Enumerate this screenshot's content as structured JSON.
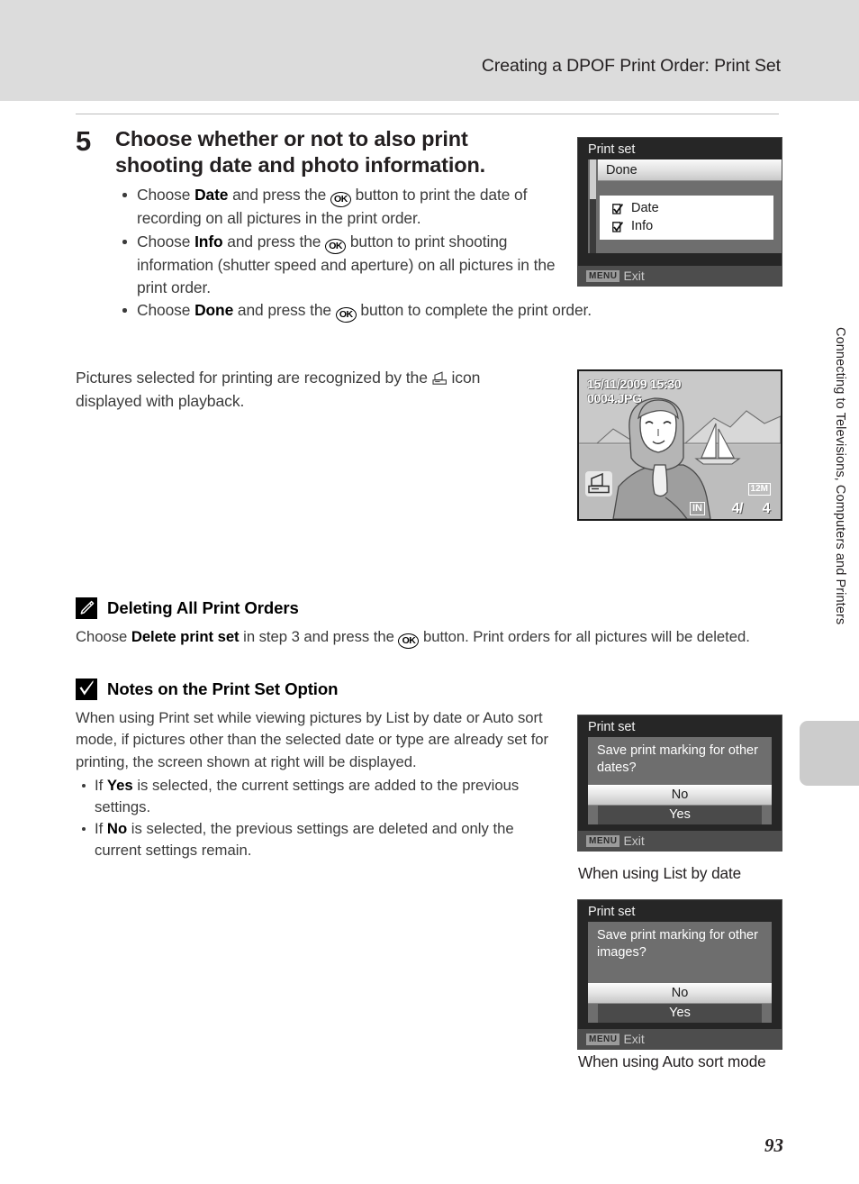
{
  "header": {
    "title": "Creating a DPOF Print Order: Print Set"
  },
  "side_tab": {
    "label": "Connecting to Televisions, Computers and Printers"
  },
  "step": {
    "number": "5",
    "heading": "Choose whether or not to also print shooting date and photo information.",
    "bullets": [
      {
        "pre": "Choose ",
        "bold": "Date",
        "mid": " and press the ",
        "icon": "OK",
        "post": " button to print the date of recording on all pictures in the print order."
      },
      {
        "pre": "Choose ",
        "bold": "Info",
        "mid": " and press the ",
        "icon": "OK",
        "post": " button to print shooting information (shutter speed and aperture) on all pictures in the print order."
      },
      {
        "pre": "Choose ",
        "bold": "Done",
        "mid": " and press the ",
        "icon": "OK",
        "post": " button to complete the print order."
      }
    ]
  },
  "paragraph": {
    "pre": "Pictures selected for printing are recognized by the ",
    "icon_name": "dpof-print-icon",
    "post": " icon displayed with playback."
  },
  "notes": [
    {
      "icon": "pencil-icon",
      "title": "Deleting All Print Orders",
      "body_pre": "Choose ",
      "body_bold": "Delete print set",
      "body_mid": " in step 3 and press the ",
      "body_icon": "OK",
      "body_post": " button. Print orders for all pictures will be deleted."
    },
    {
      "icon": "check-icon",
      "title": "Notes on the Print Set Option",
      "body": "When using Print set while viewing pictures by List by date or Auto sort mode, if pictures other than the selected date or type are already set for printing, the screen shown at right will be displayed.",
      "bullets": [
        {
          "pre": "If ",
          "bold": "Yes",
          "post": " is selected, the current settings are added to the previous settings."
        },
        {
          "pre": "If ",
          "bold": "No",
          "post": " is selected, the previous settings are deleted and only the current settings remain."
        }
      ]
    }
  ],
  "screens": {
    "print_set_menu": {
      "title": "Print set",
      "selected_row": "Done",
      "options": [
        {
          "label": "Date",
          "checked": true
        },
        {
          "label": "Info",
          "checked": true
        }
      ],
      "footer_badge": "MENU",
      "footer_label": "Exit"
    },
    "playback": {
      "date": "15/11/2009 15:30",
      "filename": "0004.JPG",
      "print_icon": "dpof-print-icon",
      "memory_badge": "IN",
      "frame_current": "4/",
      "frame_total": "4",
      "image_size_badge": "12M"
    },
    "dialog_list_by_date": {
      "title": "Print set",
      "message": "Save print marking for other dates?",
      "option_no": "No",
      "option_yes": "Yes",
      "footer_badge": "MENU",
      "footer_label": "Exit",
      "caption": "When using List by date"
    },
    "dialog_auto_sort": {
      "title": "Print set",
      "message": "Save print marking for other images?",
      "option_no": "No",
      "option_yes": "Yes",
      "footer_badge": "MENU",
      "footer_label": "Exit",
      "caption": "When using Auto sort mode"
    }
  },
  "page_number": "93"
}
